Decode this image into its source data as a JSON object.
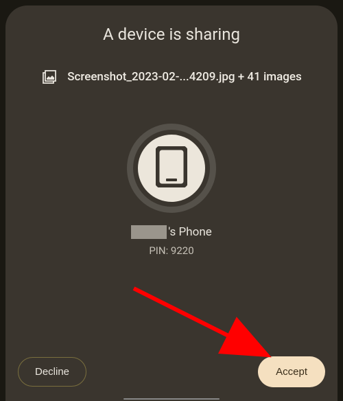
{
  "title": "A device is sharing",
  "file": {
    "name": "Screenshot_2023-02-...4209.jpg + 41 images",
    "icon": "photo-stack-icon"
  },
  "device": {
    "name_suffix": "'s Phone",
    "pin_label": "PIN: 9220",
    "icon": "phone-icon"
  },
  "buttons": {
    "decline": "Decline",
    "accept": "Accept"
  }
}
